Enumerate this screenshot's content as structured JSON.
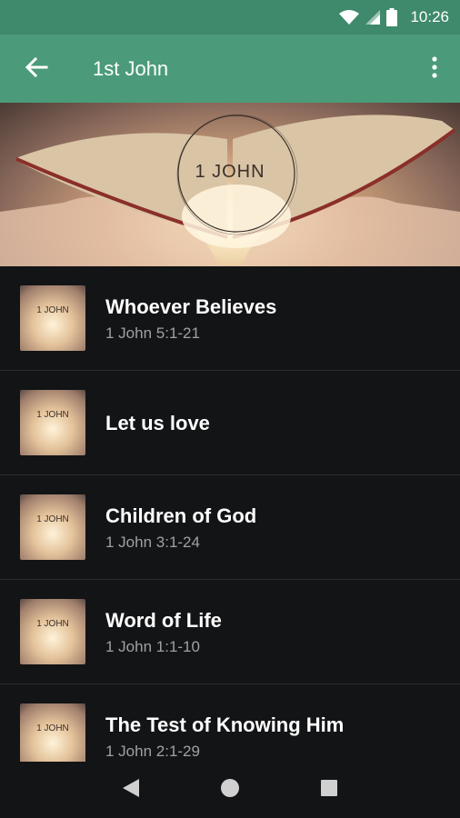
{
  "status_bar": {
    "time": "10:26"
  },
  "app_bar": {
    "title": "1st John"
  },
  "hero": {
    "label": "1 JOHN"
  },
  "thumbnail_label": "1 JOHN",
  "items": [
    {
      "title": "Whoever Believes",
      "subtitle": "1 John 5:1-21"
    },
    {
      "title": "Let us love",
      "subtitle": ""
    },
    {
      "title": "Children of God",
      "subtitle": "1 John 3:1-24"
    },
    {
      "title": "Word of Life",
      "subtitle": "1 John 1:1-10"
    },
    {
      "title": "The Test of Knowing Him",
      "subtitle": "1 John 2:1-29"
    }
  ],
  "colors": {
    "status_bar": "#3f8a6c",
    "app_bar": "#4b9b7a",
    "background": "#131416",
    "subtitle": "#9ea1a5"
  },
  "icons": {
    "back": "arrow-left",
    "more": "three-dots-vertical",
    "wifi": "wifi",
    "signal": "cell-signal",
    "battery": "battery",
    "nav_back": "triangle-back",
    "nav_home": "circle-home",
    "nav_recents": "square-recents"
  }
}
